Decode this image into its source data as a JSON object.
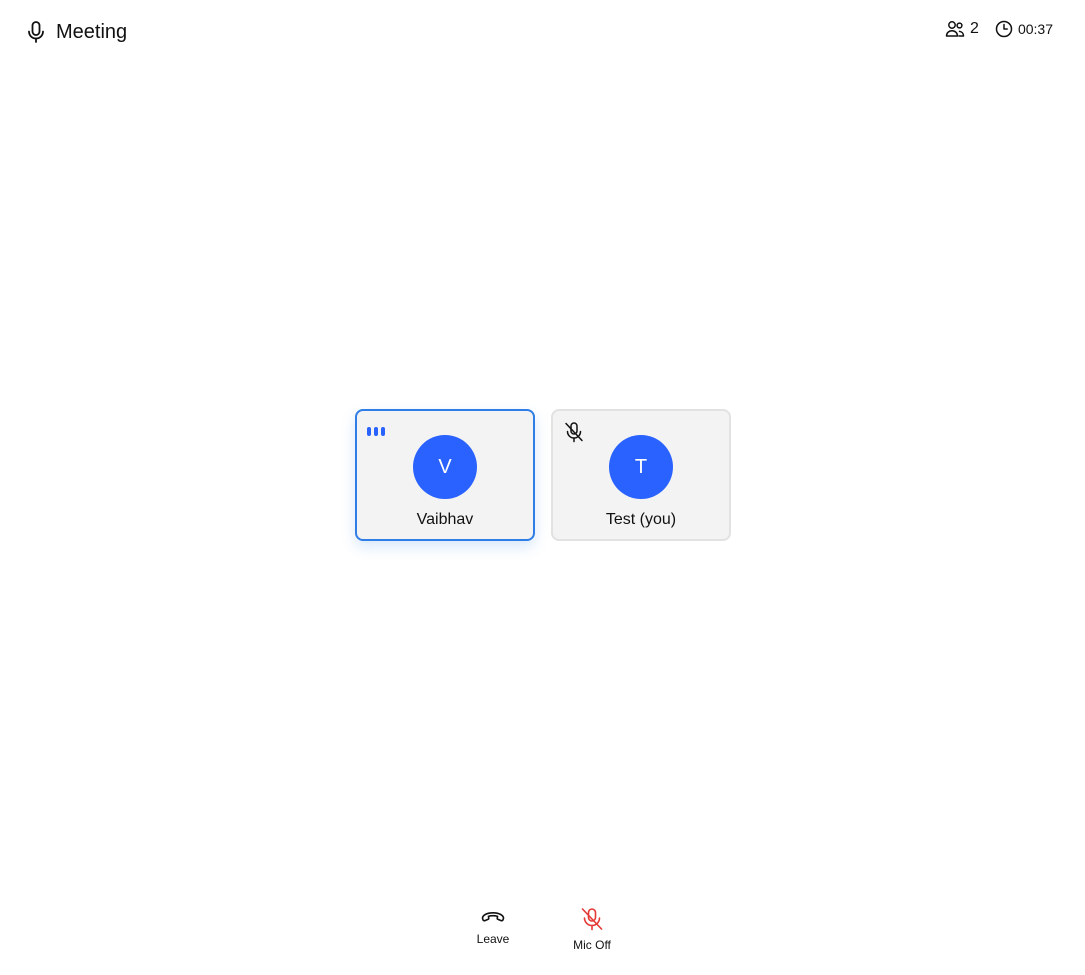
{
  "header": {
    "title": "Meeting",
    "title_icon": "microphone-icon",
    "participant_count": "2",
    "participants_icon": "people-icon",
    "elapsed": "00:37",
    "clock_icon": "clock-icon"
  },
  "participants": [
    {
      "initial": "V",
      "name": "Vaibhav",
      "speaking": true,
      "muted": false
    },
    {
      "initial": "T",
      "name": "Test (you)",
      "speaking": false,
      "muted": true
    }
  ],
  "controls": {
    "leave_label": "Leave",
    "leave_icon": "hang-up-icon",
    "mic_label": "Mic Off",
    "mic_icon": "mic-off-icon"
  },
  "colors": {
    "avatar": "#2962ff",
    "speaking_border": "#2f7de6",
    "mic_off": "#e53935"
  }
}
